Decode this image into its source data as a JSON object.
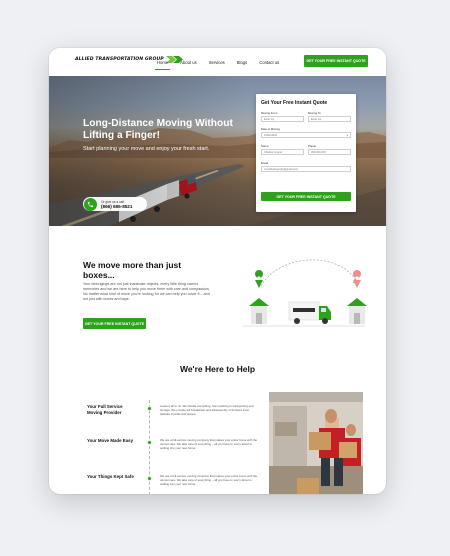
{
  "header": {
    "logo_text": "ALLIED TRANSPORTATION GROUP",
    "nav": [
      "Home",
      "About us",
      "Services",
      "Blogs",
      "Contact us"
    ],
    "cta_label": "GET YOUR FREE INSTANT QUOTE"
  },
  "hero": {
    "title": "Long-Distance Moving Without Lifting a Finger!",
    "subtitle": "Start planning your move and enjoy your fresh start.",
    "call_label": "Or give us a call:",
    "call_number": "(866) 686-8521"
  },
  "quote_form": {
    "title": "Get Your Free Instant Quote",
    "moving_from_label": "Moving From",
    "moving_from_placeholder": "Enter zip",
    "moving_to_label": "Moving To",
    "moving_to_placeholder": "Enter zip",
    "date_label": "Date of Moving",
    "date_value": "01/01/2022",
    "name_label": "Name",
    "name_value": "Charles Cooper",
    "phone_label": "Phone",
    "phone_value": "000-000-000",
    "email_label": "Email",
    "email_value": "cmcolbedsample@gmail.com",
    "submit_label": "GET YOUR FREE INSTANT QUOTE"
  },
  "section_more": {
    "title": "We move more than just boxes...",
    "body": "Your belongings are not just inanimate objects, every little thing carries memories and we are here to help you move them with care and compassion. No matter what kind of move you're looking for we can help you cover it – and not just with boxes and tape.",
    "cta_label": "GET YOUR FREE INSTANT QUOTE",
    "truck_label": "ALLIED TRANSPORTATION GROUP"
  },
  "section_help": {
    "title": "We're Here to Help",
    "services": [
      {
        "title": "Your Full Service Moving Provider",
        "desc": "Leave it all to us. We handle everything, from packing to transporting and storage. We provide full breakdown and disassembly of furniture even delicate crystals and pianos."
      },
      {
        "title": "Your Move Made Easy",
        "desc": "We are a full-service moving company that makes your entire home with the utmost care. We take care of everything – all you have to worry about is settling into your new home."
      },
      {
        "title": "Your Things Kept Safe",
        "desc": "We are a full-service moving company that makes your entire home with the utmost care. We take care of everything – all you have to worry about is settling into your new home."
      }
    ]
  },
  "colors": {
    "accent": "#2fa21d",
    "background": "#eef0f4"
  }
}
